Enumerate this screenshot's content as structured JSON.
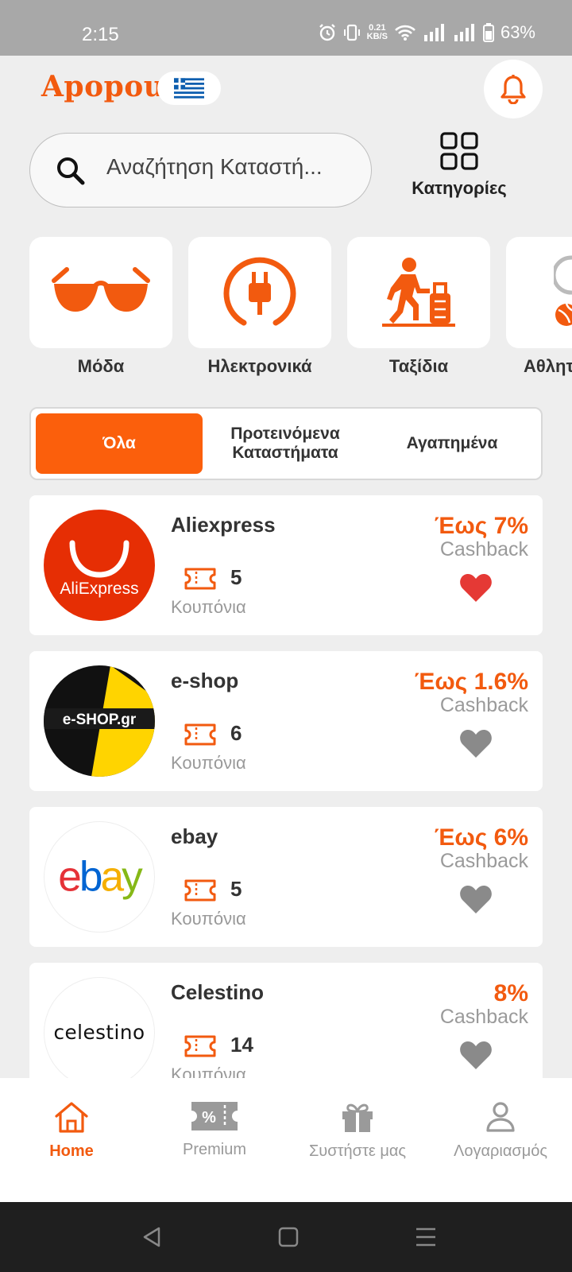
{
  "status_bar": {
    "time": "2:15",
    "net_speed_value": "0.21",
    "net_speed_unit": "KB/S",
    "battery": "63%"
  },
  "header": {
    "logo": "Apopou",
    "flag": "greece-flag",
    "notifications_icon": "bell-icon"
  },
  "search": {
    "placeholder": "Αναζήτηση Καταστή..."
  },
  "categories_button": {
    "label": "Κατηγορίες",
    "icon": "grid-icon"
  },
  "categories": [
    {
      "label": "Μόδα",
      "icon": "sunglasses-icon"
    },
    {
      "label": "Ηλεκτρονικά",
      "icon": "plug-icon"
    },
    {
      "label": "Ταξίδια",
      "icon": "traveler-icon"
    },
    {
      "label": "Αθλητ",
      "icon": "sports-icon"
    }
  ],
  "tabs": [
    {
      "label": "Όλα",
      "active": true
    },
    {
      "label": "Προτεινόμενα Καταστήματα",
      "active": false
    },
    {
      "label": "Αγαπημένα",
      "active": false
    }
  ],
  "stores": [
    {
      "name": "Aliexpress",
      "logo_text": "AliExpress",
      "coupons": "5",
      "coupons_label": "Κουπόνια",
      "cashback": "Έως 7%",
      "cashback_label": "Cashback",
      "favorite": true
    },
    {
      "name": "e-shop",
      "logo_text": "e-SHOP.gr",
      "coupons": "6",
      "coupons_label": "Κουπόνια",
      "cashback": "Έως 1.6%",
      "cashback_label": "Cashback",
      "favorite": false
    },
    {
      "name": "ebay",
      "logo_text": "ebay",
      "coupons": "5",
      "coupons_label": "Κουπόνια",
      "cashback": "Έως 6%",
      "cashback_label": "Cashback",
      "favorite": false
    },
    {
      "name": "Celestino",
      "logo_text": "celestino",
      "coupons": "14",
      "coupons_label": "Κουπόνια",
      "cashback": "8%",
      "cashback_label": "Cashback",
      "favorite": false
    }
  ],
  "bottom_nav": [
    {
      "label": "Home",
      "icon": "home-icon",
      "active": true
    },
    {
      "label": "Premium",
      "icon": "percent-ticket-icon",
      "active": false
    },
    {
      "label": "Συστήστε μας",
      "icon": "gift-icon",
      "active": false
    },
    {
      "label": "Λογαριασμός",
      "icon": "user-icon",
      "active": false
    }
  ],
  "colors": {
    "accent": "#f25a0f",
    "tab_active": "#fb5f0c",
    "favorite_on": "#e53935",
    "favorite_off": "#8a8a8a",
    "status_bar": "#a8a8a8"
  }
}
